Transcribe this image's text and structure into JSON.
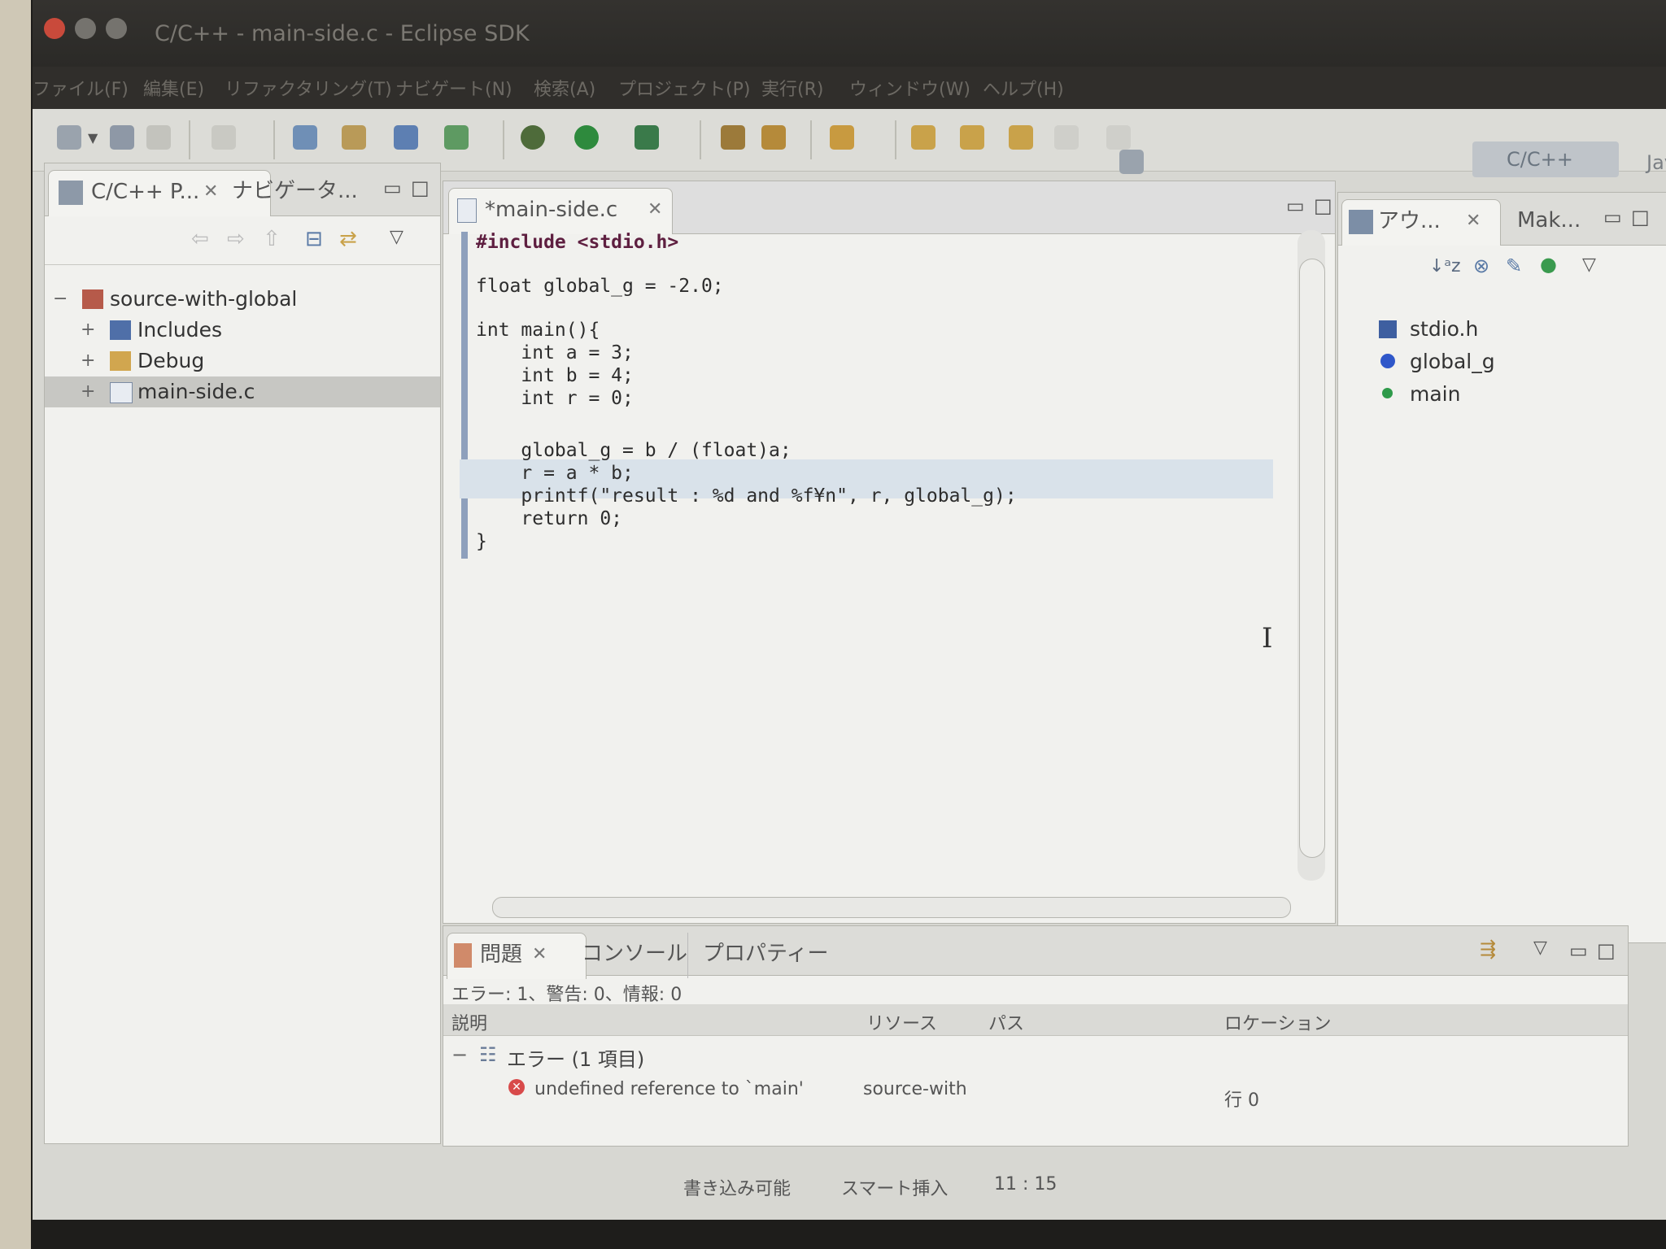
{
  "window": {
    "title": "C/C++ - main-side.c - Eclipse SDK"
  },
  "menu": [
    "ファイル(F)",
    "編集(E)",
    "リファクタリング(T)",
    "ナビゲート(N)",
    "検索(A)",
    "プロジェクト(P)",
    "実行(R)",
    "ウィンドウ(W)",
    "ヘルプ(H)"
  ],
  "perspectives": {
    "cpp": "C/C++",
    "java": "Java"
  },
  "left_panel": {
    "tabs": [
      "C/C++ P...",
      "ナビゲータ..."
    ],
    "tree": [
      {
        "label": "source-with-global",
        "expander": "−"
      },
      {
        "label": "Includes",
        "expander": "+"
      },
      {
        "label": "Debug",
        "expander": "+"
      },
      {
        "label": "main-side.c",
        "expander": "+"
      }
    ]
  },
  "editor": {
    "tab": "*main-side.c",
    "lines": [
      "#include <stdio.h>",
      "float global_g = -2.0;",
      "int main(){",
      "    int a = 3;",
      "    int b = 4;",
      "    int r = 0;",
      "    global_g = b / (float)a;",
      "    r = a * b;",
      "    printf(\"result : %d and %f¥n\", r, global_g);",
      "    return 0;",
      "}"
    ]
  },
  "outline": {
    "tabs": [
      "アウ...",
      "Mak..."
    ],
    "items": [
      "stdio.h",
      "global_g",
      "main"
    ]
  },
  "problems": {
    "tabs": [
      "問題",
      "コンソール",
      "プロパティー"
    ],
    "summary": "エラー: 1、警告: 0、情報: 0",
    "columns": [
      "説明",
      "リソース",
      "パス",
      "ロケーション"
    ],
    "group": "エラー (1 項目)",
    "group_expander": "−",
    "row": {
      "description": "undefined reference to `main'",
      "resource": "source-with",
      "location": "行 0"
    }
  },
  "statusbar": {
    "writable": "書き込み可能",
    "insert_mode": "スマート挿入",
    "position": "11 : 15"
  },
  "colors": {
    "error": "#d84a4a",
    "keyword": "#5e1f40",
    "string": "#2b3fd1",
    "variable_dot": "#2f57c9",
    "function_dot": "#2e9a4a"
  },
  "icons": [
    "new-icon",
    "save-icon",
    "print-icon",
    "debug-icon",
    "run-icon",
    "external-tools-icon",
    "search-icon",
    "outline-icon",
    "error-icon"
  ]
}
